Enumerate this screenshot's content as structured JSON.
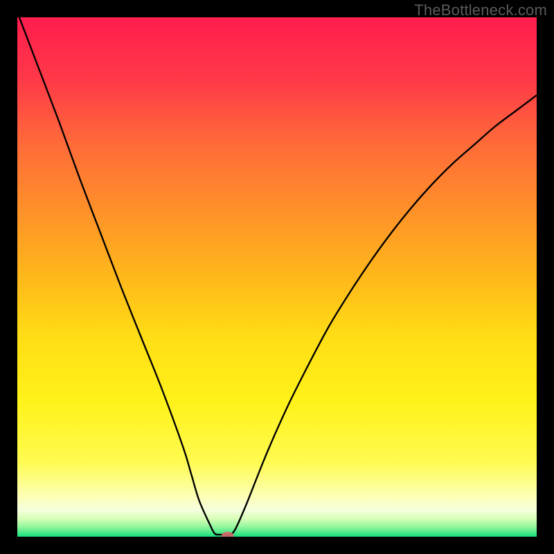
{
  "watermark": "TheBottleneck.com",
  "chart_data": {
    "type": "line",
    "title": "",
    "xlabel": "",
    "ylabel": "",
    "xlim": [
      0,
      100
    ],
    "ylim": [
      0,
      100
    ],
    "x": [
      0,
      4,
      8,
      12,
      16,
      20,
      24,
      28,
      32,
      33.5,
      35,
      37,
      38,
      39,
      40,
      41,
      42,
      44,
      48,
      52,
      56,
      60,
      64,
      68,
      72,
      76,
      80,
      84,
      88,
      92,
      96,
      100
    ],
    "values": [
      101,
      90.5,
      80,
      69,
      58.5,
      48,
      38,
      28,
      17,
      12,
      7,
      2.5,
      0.6,
      0.4,
      0.4,
      0.4,
      1.5,
      6,
      16,
      25,
      33,
      40.5,
      47,
      53,
      58.5,
      63.5,
      68,
      72,
      75.5,
      79,
      82,
      85
    ],
    "marker": {
      "x": 40.5,
      "y": 0.1
    },
    "gradient_stops": [
      {
        "offset": 0.0,
        "color": "#ff1d4e"
      },
      {
        "offset": 0.12,
        "color": "#ff3948"
      },
      {
        "offset": 0.25,
        "color": "#ff6d38"
      },
      {
        "offset": 0.38,
        "color": "#ff9328"
      },
      {
        "offset": 0.5,
        "color": "#ffb81a"
      },
      {
        "offset": 0.62,
        "color": "#ffde15"
      },
      {
        "offset": 0.74,
        "color": "#fff21a"
      },
      {
        "offset": 0.855,
        "color": "#fffb50"
      },
      {
        "offset": 0.92,
        "color": "#fcffb0"
      },
      {
        "offset": 0.948,
        "color": "#f6ffde"
      },
      {
        "offset": 0.965,
        "color": "#d9ffb8"
      },
      {
        "offset": 0.982,
        "color": "#8df59a"
      },
      {
        "offset": 1.0,
        "color": "#16e07c"
      }
    ]
  }
}
